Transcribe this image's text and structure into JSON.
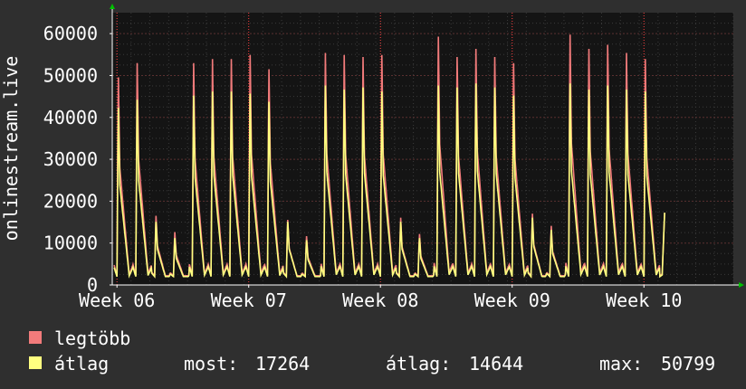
{
  "chart_data": {
    "type": "line",
    "ylabel": "onlinestream.live",
    "ylim": [
      0,
      65000
    ],
    "y_ticks": [
      0,
      10000,
      20000,
      30000,
      40000,
      50000,
      60000
    ],
    "y_tick_labels": [
      "0",
      "10000",
      "20000",
      "30000",
      "40000",
      "50000",
      "60000"
    ],
    "xlim": [
      0,
      33
    ],
    "x_ticks": [
      {
        "pos": 0.25,
        "label": "Week 06"
      },
      {
        "pos": 7.25,
        "label": "Week 07"
      },
      {
        "pos": 14.25,
        "label": "Week 08"
      },
      {
        "pos": 21.25,
        "label": "Week 09"
      },
      {
        "pos": 28.25,
        "label": "Week 10"
      }
    ],
    "week_boundaries": [
      0.25,
      7.25,
      14.25,
      21.25,
      28.25
    ],
    "grid": true,
    "daily_peaks": {
      "max": [
        51000,
        54500,
        17000,
        13000,
        54500,
        55500,
        55500,
        56500,
        53000,
        16000,
        12000,
        57000,
        56500,
        56000,
        56500,
        16500,
        12500,
        61000,
        56000,
        58000,
        56000,
        54500,
        17500,
        14500,
        61500,
        58000,
        59000,
        57000,
        55500
      ],
      "avg": [
        43500,
        45500,
        15500,
        11500,
        46500,
        47500,
        47500,
        47000,
        45000,
        15500,
        11000,
        49000,
        48000,
        48500,
        47500,
        15500,
        11500,
        49000,
        48500,
        49500,
        48500,
        46500,
        16500,
        13500,
        49500,
        48000,
        49000,
        48000,
        47500
      ]
    },
    "final_value": 17264,
    "series": [
      {
        "name": "legtöbb",
        "color": "#f27b7b"
      },
      {
        "name": "átlag",
        "color": "#ffff80"
      }
    ],
    "stats": {
      "current_label": "most:",
      "current_value": "17264",
      "average_label": "átlag:",
      "average_value": "14644",
      "max_label": "max:",
      "max_value": "50799"
    }
  },
  "colors": {
    "background": "#2f2f2f",
    "plot_background": "#141414",
    "grid_minor": "#3a3a3a",
    "grid_major": "#5a3030",
    "week_line": "#ff4040",
    "axis_arrow": "#00c000",
    "text": "#ffffff"
  }
}
